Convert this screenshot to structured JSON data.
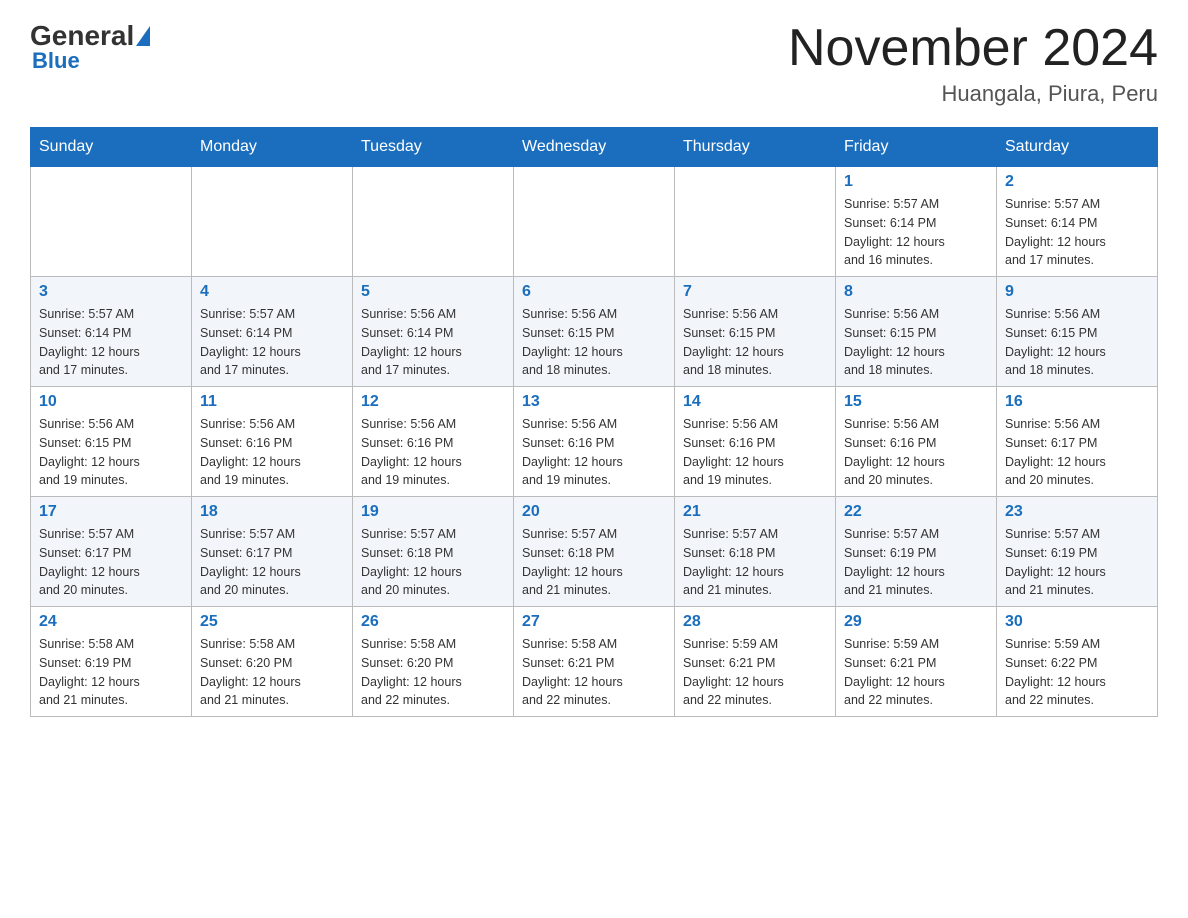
{
  "header": {
    "logo": {
      "general": "General",
      "blue": "Blue"
    },
    "title": "November 2024",
    "location": "Huangala, Piura, Peru"
  },
  "weekdays": [
    "Sunday",
    "Monday",
    "Tuesday",
    "Wednesday",
    "Thursday",
    "Friday",
    "Saturday"
  ],
  "weeks": [
    [
      {
        "day": "",
        "info": ""
      },
      {
        "day": "",
        "info": ""
      },
      {
        "day": "",
        "info": ""
      },
      {
        "day": "",
        "info": ""
      },
      {
        "day": "",
        "info": ""
      },
      {
        "day": "1",
        "info": "Sunrise: 5:57 AM\nSunset: 6:14 PM\nDaylight: 12 hours\nand 16 minutes."
      },
      {
        "day": "2",
        "info": "Sunrise: 5:57 AM\nSunset: 6:14 PM\nDaylight: 12 hours\nand 17 minutes."
      }
    ],
    [
      {
        "day": "3",
        "info": "Sunrise: 5:57 AM\nSunset: 6:14 PM\nDaylight: 12 hours\nand 17 minutes."
      },
      {
        "day": "4",
        "info": "Sunrise: 5:57 AM\nSunset: 6:14 PM\nDaylight: 12 hours\nand 17 minutes."
      },
      {
        "day": "5",
        "info": "Sunrise: 5:56 AM\nSunset: 6:14 PM\nDaylight: 12 hours\nand 17 minutes."
      },
      {
        "day": "6",
        "info": "Sunrise: 5:56 AM\nSunset: 6:15 PM\nDaylight: 12 hours\nand 18 minutes."
      },
      {
        "day": "7",
        "info": "Sunrise: 5:56 AM\nSunset: 6:15 PM\nDaylight: 12 hours\nand 18 minutes."
      },
      {
        "day": "8",
        "info": "Sunrise: 5:56 AM\nSunset: 6:15 PM\nDaylight: 12 hours\nand 18 minutes."
      },
      {
        "day": "9",
        "info": "Sunrise: 5:56 AM\nSunset: 6:15 PM\nDaylight: 12 hours\nand 18 minutes."
      }
    ],
    [
      {
        "day": "10",
        "info": "Sunrise: 5:56 AM\nSunset: 6:15 PM\nDaylight: 12 hours\nand 19 minutes."
      },
      {
        "day": "11",
        "info": "Sunrise: 5:56 AM\nSunset: 6:16 PM\nDaylight: 12 hours\nand 19 minutes."
      },
      {
        "day": "12",
        "info": "Sunrise: 5:56 AM\nSunset: 6:16 PM\nDaylight: 12 hours\nand 19 minutes."
      },
      {
        "day": "13",
        "info": "Sunrise: 5:56 AM\nSunset: 6:16 PM\nDaylight: 12 hours\nand 19 minutes."
      },
      {
        "day": "14",
        "info": "Sunrise: 5:56 AM\nSunset: 6:16 PM\nDaylight: 12 hours\nand 19 minutes."
      },
      {
        "day": "15",
        "info": "Sunrise: 5:56 AM\nSunset: 6:16 PM\nDaylight: 12 hours\nand 20 minutes."
      },
      {
        "day": "16",
        "info": "Sunrise: 5:56 AM\nSunset: 6:17 PM\nDaylight: 12 hours\nand 20 minutes."
      }
    ],
    [
      {
        "day": "17",
        "info": "Sunrise: 5:57 AM\nSunset: 6:17 PM\nDaylight: 12 hours\nand 20 minutes."
      },
      {
        "day": "18",
        "info": "Sunrise: 5:57 AM\nSunset: 6:17 PM\nDaylight: 12 hours\nand 20 minutes."
      },
      {
        "day": "19",
        "info": "Sunrise: 5:57 AM\nSunset: 6:18 PM\nDaylight: 12 hours\nand 20 minutes."
      },
      {
        "day": "20",
        "info": "Sunrise: 5:57 AM\nSunset: 6:18 PM\nDaylight: 12 hours\nand 21 minutes."
      },
      {
        "day": "21",
        "info": "Sunrise: 5:57 AM\nSunset: 6:18 PM\nDaylight: 12 hours\nand 21 minutes."
      },
      {
        "day": "22",
        "info": "Sunrise: 5:57 AM\nSunset: 6:19 PM\nDaylight: 12 hours\nand 21 minutes."
      },
      {
        "day": "23",
        "info": "Sunrise: 5:57 AM\nSunset: 6:19 PM\nDaylight: 12 hours\nand 21 minutes."
      }
    ],
    [
      {
        "day": "24",
        "info": "Sunrise: 5:58 AM\nSunset: 6:19 PM\nDaylight: 12 hours\nand 21 minutes."
      },
      {
        "day": "25",
        "info": "Sunrise: 5:58 AM\nSunset: 6:20 PM\nDaylight: 12 hours\nand 21 minutes."
      },
      {
        "day": "26",
        "info": "Sunrise: 5:58 AM\nSunset: 6:20 PM\nDaylight: 12 hours\nand 22 minutes."
      },
      {
        "day": "27",
        "info": "Sunrise: 5:58 AM\nSunset: 6:21 PM\nDaylight: 12 hours\nand 22 minutes."
      },
      {
        "day": "28",
        "info": "Sunrise: 5:59 AM\nSunset: 6:21 PM\nDaylight: 12 hours\nand 22 minutes."
      },
      {
        "day": "29",
        "info": "Sunrise: 5:59 AM\nSunset: 6:21 PM\nDaylight: 12 hours\nand 22 minutes."
      },
      {
        "day": "30",
        "info": "Sunrise: 5:59 AM\nSunset: 6:22 PM\nDaylight: 12 hours\nand 22 minutes."
      }
    ]
  ]
}
